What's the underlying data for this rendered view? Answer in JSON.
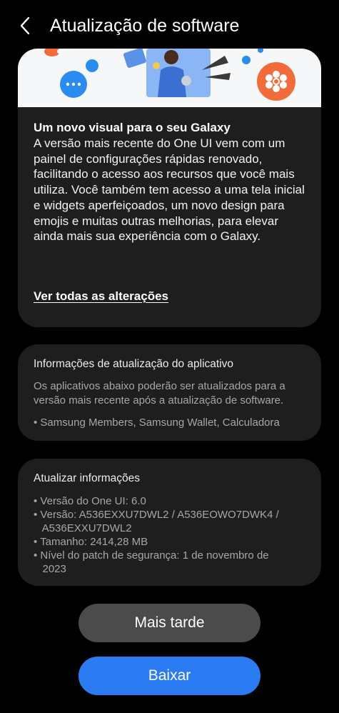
{
  "header": {
    "title": "Atualização de software",
    "back_icon": "back-arrow-icon"
  },
  "update_card": {
    "headline": "Um novo visual para o seu Galaxy",
    "description": "A versão mais recente do One UI vem com um painel de configurações rápidas renovado, facilitando o acesso aos recursos que você mais utiliza. Você também tem acesso a uma tela inicial e widgets aperfeiçoados, um novo design para emojis e muitas outras melhorias, para elevar ainda mais sua experiência com o Galaxy.",
    "link": "Ver todas as alterações"
  },
  "app_update_card": {
    "title": "Informações de atualização do aplicativo",
    "body": "Os aplicativos abaixo poderão ser atualizados para a versão mais recente após a atualização de software.",
    "apps": "• Samsung Members, Samsung Wallet, Calculadora"
  },
  "info_card": {
    "title": "Atualizar informações",
    "items": [
      "• Versão do One UI: 6.0",
      "• Versão: A536EXXU7DWL2 / A536EOWO7DWK4 /",
      "   A536EXXU7DWL2",
      "• Tamanho: 2414,28 MB",
      "• Nível do patch de segurança: 1 de novembro de",
      "   2023"
    ]
  },
  "buttons": {
    "later": "Mais tarde",
    "download": "Baixar"
  },
  "colors": {
    "background": "#000000",
    "card": "#1e1e1e",
    "primary_button": "#2b7cf3",
    "secondary_button": "#4b4b4b"
  }
}
